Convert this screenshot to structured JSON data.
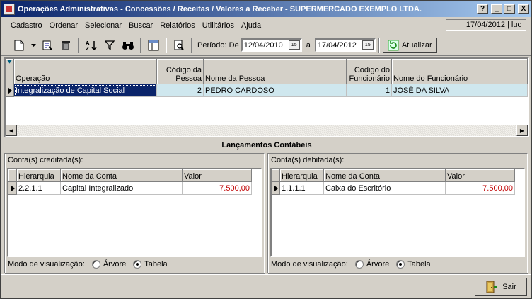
{
  "window": {
    "title": "Operações Administrativas - Concessões / Receitas / Valores a Receber - SUPERMERCADO EXEMPLO LTDA.",
    "help": "?",
    "minimize": "_",
    "maximize": "□",
    "close": "X"
  },
  "menu": {
    "items": [
      "Cadastro",
      "Ordenar",
      "Selecionar",
      "Buscar",
      "Relatórios",
      "Utilitários",
      "Ajuda"
    ],
    "status": "17/04/2012 | luc"
  },
  "toolbar": {
    "periodo_label": "Período: De",
    "date_from": "12/04/2010",
    "a_label": "a",
    "date_to": "17/04/2012",
    "atualizar_label": "Atualizar",
    "icons": [
      "new-icon",
      "dropdown-arrow-icon",
      "open-icon",
      "delete-icon",
      "sort-icon",
      "filter-icon",
      "binoculars-icon",
      "columns-icon",
      "preview-icon",
      "refresh-icon"
    ]
  },
  "main_grid": {
    "columns": [
      "Operação",
      "Código da Pessoa",
      "Nome da Pessoa",
      "Código do Funcionário",
      "Nome do Funcionário"
    ],
    "rows": [
      {
        "operacao": "Integralização de Capital Social",
        "codigo_pessoa": "2",
        "nome_pessoa": "PEDRO CARDOSO",
        "codigo_funcionario": "1",
        "nome_funcionario": "JOSÉ DA SILVA"
      }
    ]
  },
  "lancamentos": {
    "title": "Lançamentos Contábeis",
    "credit": {
      "title": "Conta(s) creditada(s):",
      "columns": [
        "Hierarquia",
        "Nome da Conta",
        "Valor"
      ],
      "rows": [
        {
          "hierarquia": "2.2.1.1",
          "nome": "Capital Integralizado",
          "valor": "7.500,00"
        }
      ]
    },
    "debit": {
      "title": "Conta(s) debitada(s):",
      "columns": [
        "Hierarquia",
        "Nome da Conta",
        "Valor"
      ],
      "rows": [
        {
          "hierarquia": "1.1.1.1",
          "nome": "Caixa do Escritório",
          "valor": "7.500,00"
        }
      ]
    },
    "view_mode": {
      "label": "Modo de visualização:",
      "options": [
        "Árvore",
        "Tabela"
      ],
      "selected": "Tabela"
    }
  },
  "footer": {
    "sair_label": "Sair"
  },
  "colors": {
    "title_start": "#0a246a",
    "title_end": "#a6caf0",
    "selected_row": "#cfe7ee",
    "value_red": "#c00000"
  }
}
